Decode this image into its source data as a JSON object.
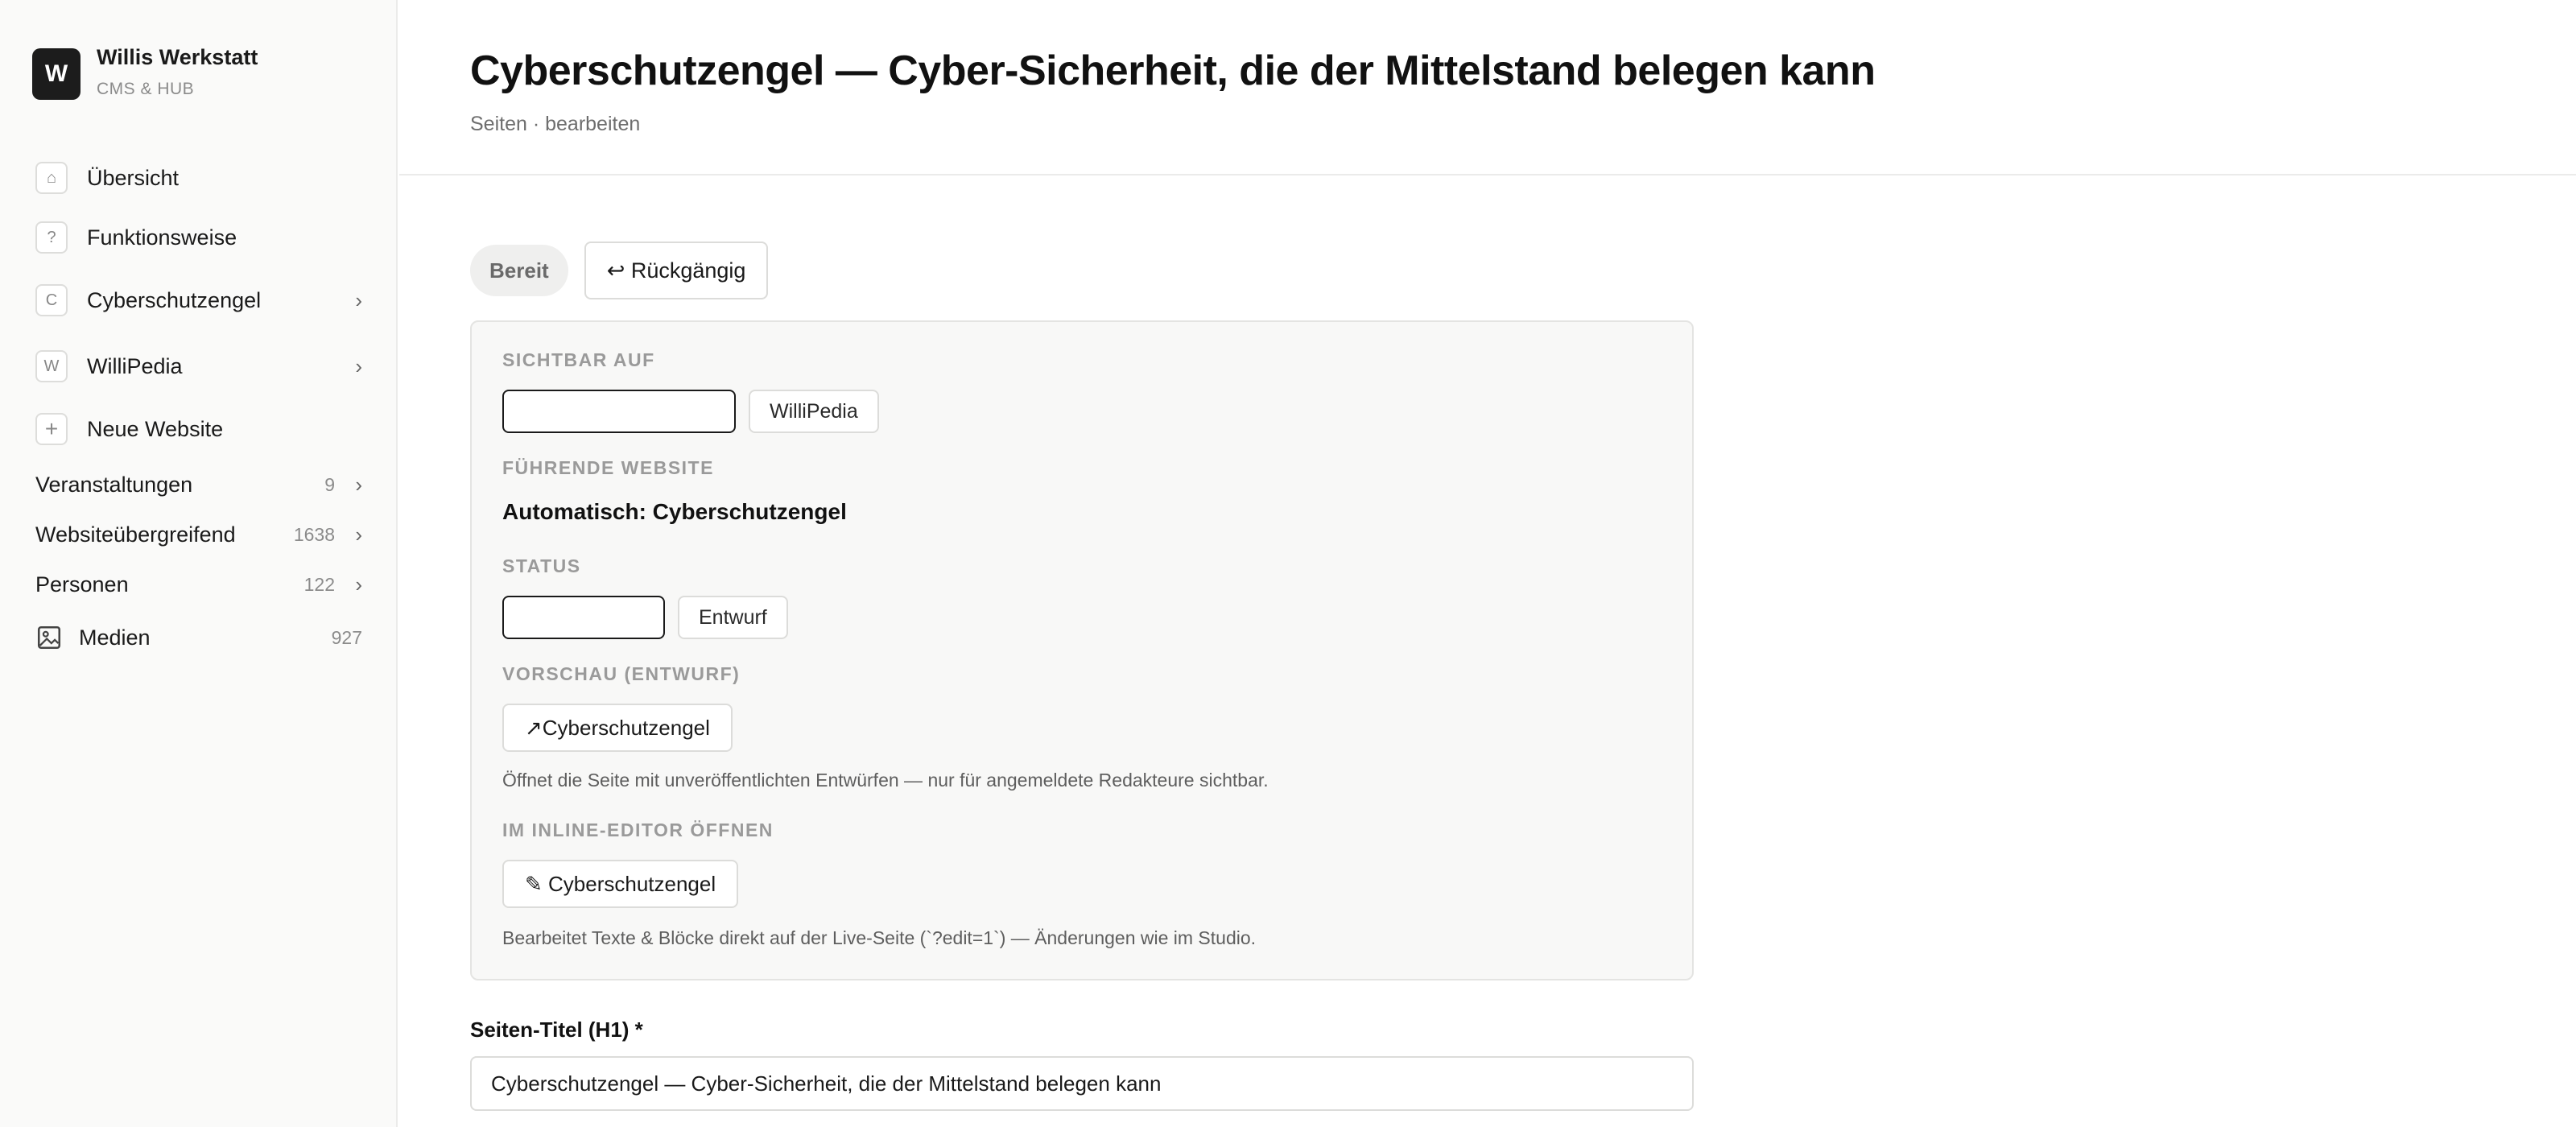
{
  "brand": {
    "logo_letter": "W",
    "name": "Willis Werkstatt",
    "subtitle": "CMS & HUB"
  },
  "sidebar": {
    "items": [
      {
        "badge": "⌂",
        "label": "Übersicht"
      },
      {
        "badge": "?",
        "label": "Funktionsweise"
      },
      {
        "badge": "C",
        "label": "Cyberschutzengel",
        "chevron": "›"
      },
      {
        "badge": "W",
        "label": "WilliPedia",
        "chevron": "›"
      },
      {
        "badge": "+",
        "label": "Neue Website"
      }
    ],
    "collections": [
      {
        "label": "Veranstaltungen",
        "count": "9",
        "chevron": "›"
      },
      {
        "label": "Websiteübergreifend",
        "count": "1638",
        "chevron": "›"
      },
      {
        "label": "Personen",
        "count": "122",
        "chevron": "›"
      },
      {
        "label": "Medien",
        "count": "927",
        "icon": "image-icon"
      }
    ]
  },
  "header": {
    "title": "Cyberschutzengel — Cyber-Sicherheit, die der Mittelstand belegen kann",
    "breadcrumb": "Seiten · bearbeiten"
  },
  "toolbar": {
    "status": "Bereit",
    "undo_label": "↩ Rückgängig"
  },
  "panel": {
    "visible_on": {
      "label": "Sichtbar auf",
      "option": "WilliPedia"
    },
    "leading_site": {
      "label": "Führende Website",
      "value": "Automatisch: Cyberschutzengel"
    },
    "status": {
      "label": "Status",
      "option": "Entwurf"
    },
    "preview": {
      "label": "Vorschau (Entwurf)",
      "button": "↗Cyberschutzengel",
      "help": "Öffnet die Seite mit unveröffentlichten Entwürfen — nur für angemeldete Redakteure sichtbar."
    },
    "inline_editor": {
      "label": "Im Inline-Editor öffnen",
      "button": "✎ Cyberschutzengel",
      "help": "Bearbeitet Texte & Blöcke direkt auf der Live-Seite (`?edit=1`) — Änderungen wie im Studio."
    }
  },
  "page_title_field": {
    "label": "Seiten-Titel (H1) *",
    "value": "Cyberschutzengel — Cyber-Sicherheit, die der Mittelstand belegen kann"
  }
}
